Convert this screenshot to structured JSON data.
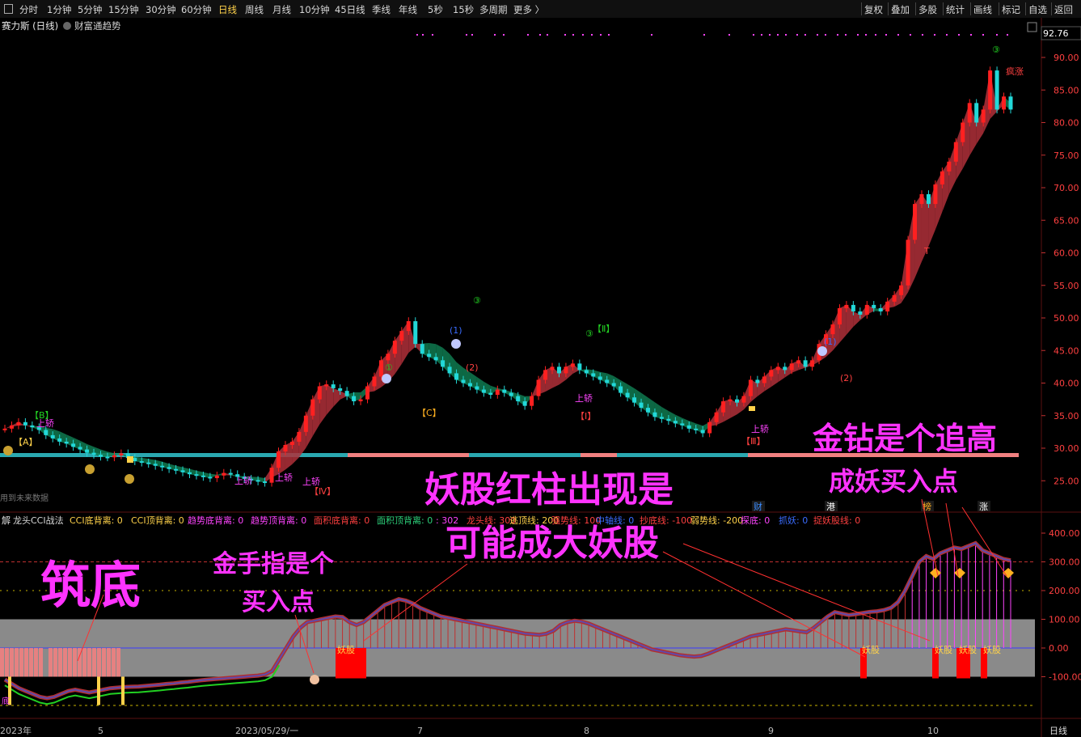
{
  "toolbar": {
    "periods": [
      {
        "label": "分时"
      },
      {
        "label": "1分钟"
      },
      {
        "label": "5分钟"
      },
      {
        "label": "15分钟"
      },
      {
        "label": "30分钟"
      },
      {
        "label": "60分钟"
      },
      {
        "label": "日线",
        "active": true
      },
      {
        "label": "周线"
      },
      {
        "label": "月线"
      },
      {
        "label": "10分钟"
      },
      {
        "label": "45日线"
      },
      {
        "label": "季线"
      },
      {
        "label": "年线"
      },
      {
        "label": "5秒"
      },
      {
        "label": "15秒"
      },
      {
        "label": "多周期"
      },
      {
        "label": "更多 〉"
      }
    ],
    "tools": [
      {
        "label": "复权"
      },
      {
        "label": "叠加"
      },
      {
        "label": "多股"
      },
      {
        "label": "统计"
      },
      {
        "label": "画线"
      },
      {
        "label": "标记"
      },
      {
        "label": "自选"
      },
      {
        "label": "返回"
      }
    ]
  },
  "main_chart": {
    "title": "赛力斯 (日线)",
    "indicator": "财富通趋势",
    "top_price": "92.76",
    "future_note": "用到未来数据",
    "price_ticks": [
      "90.00",
      "85.00",
      "80.00",
      "75.00",
      "70.00",
      "65.00",
      "60.00",
      "55.00",
      "50.00",
      "45.00",
      "40.00",
      "35.00",
      "30.00",
      "25.00"
    ],
    "markers": {
      "A": "【A】",
      "B": "【B】",
      "C": "【C】",
      "I": "【Ⅰ】",
      "II": "【Ⅱ】",
      "III": "【Ⅲ】",
      "IV": "【Ⅳ】",
      "shangjiao": "上轿",
      "circ1": "①",
      "circ2": "②",
      "circ3": "③",
      "par1": "(1)",
      "par2": "(2)",
      "t_mark": "T",
      "fengzhang": "疯涨",
      "jie": "解"
    },
    "bottom_tags": [
      {
        "label": "财",
        "color": "#3a8cff"
      },
      {
        "label": "港",
        "color": "#ffffff"
      },
      {
        "label": "榜",
        "color": "#ffb020"
      },
      {
        "label": "涨",
        "color": "#ffffff"
      }
    ]
  },
  "cci_panel": {
    "legend": [
      {
        "label": "龙头CCI战法",
        "color": "#d8d8d8"
      },
      {
        "label": "CCI底背离: 0",
        "color": "#ffd24a"
      },
      {
        "label": "CCI顶背离: 0",
        "color": "#ffd24a"
      },
      {
        "label": "趋势底背离: 0",
        "color": "#ff44ff"
      },
      {
        "label": "趋势顶背离: 0",
        "color": "#ff44ff"
      },
      {
        "label": "面积底背离: 0",
        "color": "#ff4040"
      },
      {
        "label": "面积顶背离: 0",
        "color": "#2dd07a"
      },
      {
        "label": ": 302",
        "color": "#ff44ff"
      },
      {
        "label": "龙头线: 300",
        "color": "#ff4040"
      },
      {
        "label": "逃顶线: 200",
        "color": "#ffd24a"
      },
      {
        "label": "强势线: 100",
        "color": "#ff4040"
      },
      {
        "label": "中轴线: 0",
        "color": "#3a6cff"
      },
      {
        "label": "抄底线: -100",
        "color": "#ff4040"
      },
      {
        "label": "弱势线: -200",
        "color": "#ffd24a"
      },
      {
        "label": "探底: 0",
        "color": "#ff44ff"
      },
      {
        "label": "抓妖: 0",
        "color": "#3a6cff"
      },
      {
        "label": "捉妖股线: 0",
        "color": "#ff4040"
      }
    ],
    "cci_ticks": [
      "400.00",
      "300.00",
      "200.00",
      "100.00",
      "0.00",
      "-100.00"
    ],
    "yaogu_label": "妖股",
    "di_label": "底"
  },
  "x_axis": {
    "labels": [
      "2023年",
      "5",
      "2023/05/29/一",
      "7",
      "8",
      "9",
      "10"
    ],
    "period_button": "日线"
  },
  "annotations": {
    "zhudi": "筑底",
    "jinshouzhi_1": "金手指是个",
    "jinshouzhi_2": "买入点",
    "yaogu_1": "妖股红柱出现是",
    "yaogu_2": "可能成大妖股",
    "jinzuan_1": "金钻是个追高",
    "jinzuan_2": "成妖买入点"
  },
  "colors": {
    "up": "#ff2020",
    "down": "#22d8d8",
    "band_red": "#b0303a",
    "band_green": "#0f7a50",
    "pink_text": "#ff33ff",
    "gray_zone": "#8a8a8a",
    "grid_red": "#c03030",
    "grid_yellow": "#c8b400"
  },
  "chart_data": {
    "type": "candlestick",
    "title": "赛力斯 (日线)",
    "ylim": [
      23,
      92.76
    ],
    "close_series": [
      33.0,
      33.5,
      34.0,
      33.5,
      33.2,
      32.8,
      32.0,
      31.5,
      31.0,
      30.7,
      30.2,
      29.8,
      29.3,
      29.0,
      28.7,
      28.6,
      28.9,
      29.2,
      28.5,
      28.0,
      27.8,
      27.6,
      27.3,
      27.1,
      26.8,
      26.6,
      26.3,
      26.0,
      25.8,
      25.6,
      25.4,
      25.8,
      26.2,
      26.0,
      25.6,
      25.3,
      25.1,
      24.9,
      24.7,
      27.0,
      29.5,
      30.5,
      31.0,
      32.5,
      35.0,
      37.5,
      39.5,
      39.8,
      39.2,
      38.8,
      38.0,
      37.2,
      37.5,
      39.5,
      41.0,
      43.5,
      44.5,
      46.5,
      48.0,
      49.5,
      46.0,
      44.5,
      44.0,
      43.5,
      42.5,
      41.5,
      40.5,
      40.0,
      39.5,
      39.0,
      38.5,
      38.2,
      39.0,
      38.5,
      38.0,
      37.2,
      36.5,
      38.0,
      40.5,
      42.0,
      42.5,
      41.5,
      42.5,
      43.0,
      42.0,
      41.5,
      41.0,
      40.5,
      40.0,
      39.5,
      38.5,
      37.8,
      37.0,
      36.2,
      35.5,
      34.8,
      34.5,
      34.2,
      33.8,
      33.5,
      33.0,
      32.8,
      32.3,
      34.0,
      35.5,
      37.2,
      37.5,
      37.0,
      38.0,
      40.5,
      40.0,
      41.0,
      42.0,
      42.5,
      42.0,
      43.0,
      43.5,
      42.5,
      43.5,
      46.0,
      47.5,
      49.0,
      51.5,
      52.0,
      51.0,
      50.5,
      52.0,
      51.5,
      51.0,
      52.5,
      53.5,
      55.0,
      62.0,
      67.5,
      69.0,
      67.5,
      70.5,
      72.5,
      74.0,
      77.0,
      80.0,
      83.0,
      80.0,
      82.0,
      88.0,
      82.0,
      84.0,
      82.0
    ],
    "cci_series": [
      -110,
      -125,
      -140,
      -150,
      -160,
      -170,
      -175,
      -170,
      -160,
      -150,
      -145,
      -150,
      -155,
      -150,
      -145,
      -140,
      -138,
      -136,
      -135,
      -134,
      -132,
      -130,
      -128,
      -125,
      -123,
      -120,
      -118,
      -115,
      -112,
      -110,
      -108,
      -106,
      -104,
      -102,
      -100,
      -98,
      -96,
      -92,
      -80,
      -40,
      0,
      40,
      70,
      90,
      95,
      100,
      105,
      110,
      108,
      90,
      80,
      90,
      110,
      130,
      150,
      160,
      170,
      165,
      155,
      140,
      130,
      120,
      110,
      105,
      100,
      95,
      90,
      85,
      80,
      75,
      70,
      65,
      60,
      55,
      50,
      48,
      46,
      50,
      60,
      80,
      90,
      95,
      92,
      85,
      75,
      65,
      55,
      45,
      35,
      25,
      15,
      5,
      -5,
      -10,
      -15,
      -20,
      -25,
      -28,
      -30,
      -28,
      -20,
      -10,
      0,
      10,
      20,
      30,
      40,
      45,
      50,
      55,
      60,
      65,
      62,
      58,
      55,
      70,
      90,
      110,
      125,
      120,
      115,
      118,
      122,
      126,
      128,
      132,
      140,
      160,
      200,
      250,
      300,
      320,
      310,
      330,
      340,
      350,
      345,
      355,
      365,
      340,
      330,
      320,
      310,
      305
    ]
  }
}
